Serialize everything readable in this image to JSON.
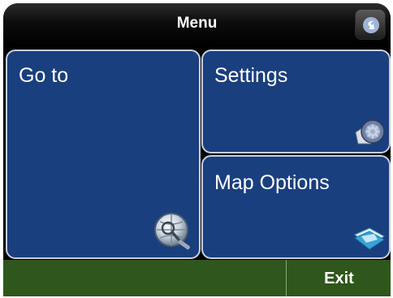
{
  "header": {
    "title": "Menu",
    "back_icon": "back-arrow-icon"
  },
  "tiles": [
    {
      "label": "Go to",
      "icon": "globe-magnifier-icon"
    },
    {
      "label": "Settings",
      "icon": "settings-disc-icon"
    },
    {
      "label": "Map Options",
      "icon": "map-folder-icon"
    }
  ],
  "footer": {
    "exit_label": "Exit"
  },
  "colors": {
    "tile_background": "#1a3f7e",
    "tile_border": "#c9cfd9",
    "title_bar": "#000000",
    "footer_background": "#2f561b",
    "text": "#ffffff"
  }
}
